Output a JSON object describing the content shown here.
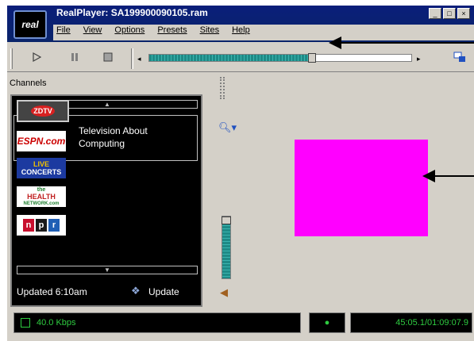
{
  "window": {
    "title": "RealPlayer: SA199900090105.ram",
    "logo_text": "real",
    "controls": [
      "_",
      "□",
      "×"
    ]
  },
  "menu": [
    "File",
    "View",
    "Options",
    "Presets",
    "Sites",
    "Help"
  ],
  "transport": {
    "play_icon": "play-icon",
    "pause_icon": "pause-icon",
    "stop_icon": "stop-icon",
    "seek_left": "◂",
    "seek_right": "▸",
    "seek_progress": 0.62
  },
  "channels": {
    "label": "Channels",
    "scroll_up": "▲",
    "scroll_down": "▼",
    "selected": {
      "logo": "ZDTV",
      "description": "Television About Computing"
    },
    "items": [
      {
        "name": "ZDTV",
        "text": "ZD TV"
      },
      {
        "name": "ESPN",
        "text": "ESPN.com"
      },
      {
        "name": "Live Concerts",
        "text_top": "LIVE",
        "text_bottom": "CONCERTS"
      },
      {
        "name": "Health Network",
        "text_top": "the",
        "text_mid": "HEALTH",
        "text_bottom": "NETWORK.com"
      },
      {
        "name": "NPR",
        "letters": [
          "n",
          "p",
          "r"
        ],
        "colors": [
          "#c8102e",
          "#1a1a1a",
          "#1f5fb5"
        ]
      }
    ],
    "updated": "Updated 6:10am",
    "update_label": "Update"
  },
  "volume": {
    "level": 1.0
  },
  "status": {
    "rate": "40.0 Kbps",
    "indicator": "●",
    "time": "45:05.1/01:09:07.9"
  },
  "colors": {
    "video_placeholder": "#ff00ff",
    "status_text": "#2ecc40",
    "title_bar": "#0a246a"
  }
}
